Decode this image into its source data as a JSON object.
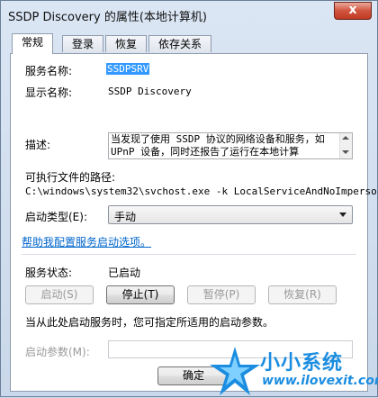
{
  "window": {
    "title": "SSDP Discovery 的属性(本地计算机)",
    "close_glyph": "x"
  },
  "tabs": [
    {
      "label": "常规"
    },
    {
      "label": "登录"
    },
    {
      "label": "恢复"
    },
    {
      "label": "依存关系"
    }
  ],
  "general": {
    "service_name_label": "服务名称:",
    "service_name_value": "SSDPSRV",
    "display_name_label": "显示名称:",
    "display_name_value": "SSDP Discovery",
    "description_label": "描述:",
    "description_value": "当发现了使用 SSDP 协议的网络设备和服务，如 UPnP 设备，同时还报告了运行在本地计算",
    "exe_path_label": "可执行文件的路径:",
    "exe_path_value": "C:\\windows\\system32\\svchost.exe -k LocalServiceAndNoImpersor",
    "startup_type_label": "启动类型(E):",
    "startup_type_value": "手动",
    "help_link": "帮助我配置服务启动选项。",
    "status_label": "服务状态:",
    "status_value": "已启动",
    "buttons": {
      "start": "启动(S)",
      "stop": "停止(T)",
      "pause": "暂停(P)",
      "resume": "恢复(R)"
    },
    "hint_text": "当从此处启动服务时，您可指定所适用的启动参数。",
    "start_params_label": "启动参数(M):",
    "start_params_value": ""
  },
  "footer": {
    "ok_label": "确定"
  },
  "watermark": {
    "title": "小小系统",
    "url": "www.ilovexit.com"
  },
  "colors": {
    "selection": "#3399ff",
    "link": "#0066cc",
    "watermark": "#1b8de0"
  }
}
